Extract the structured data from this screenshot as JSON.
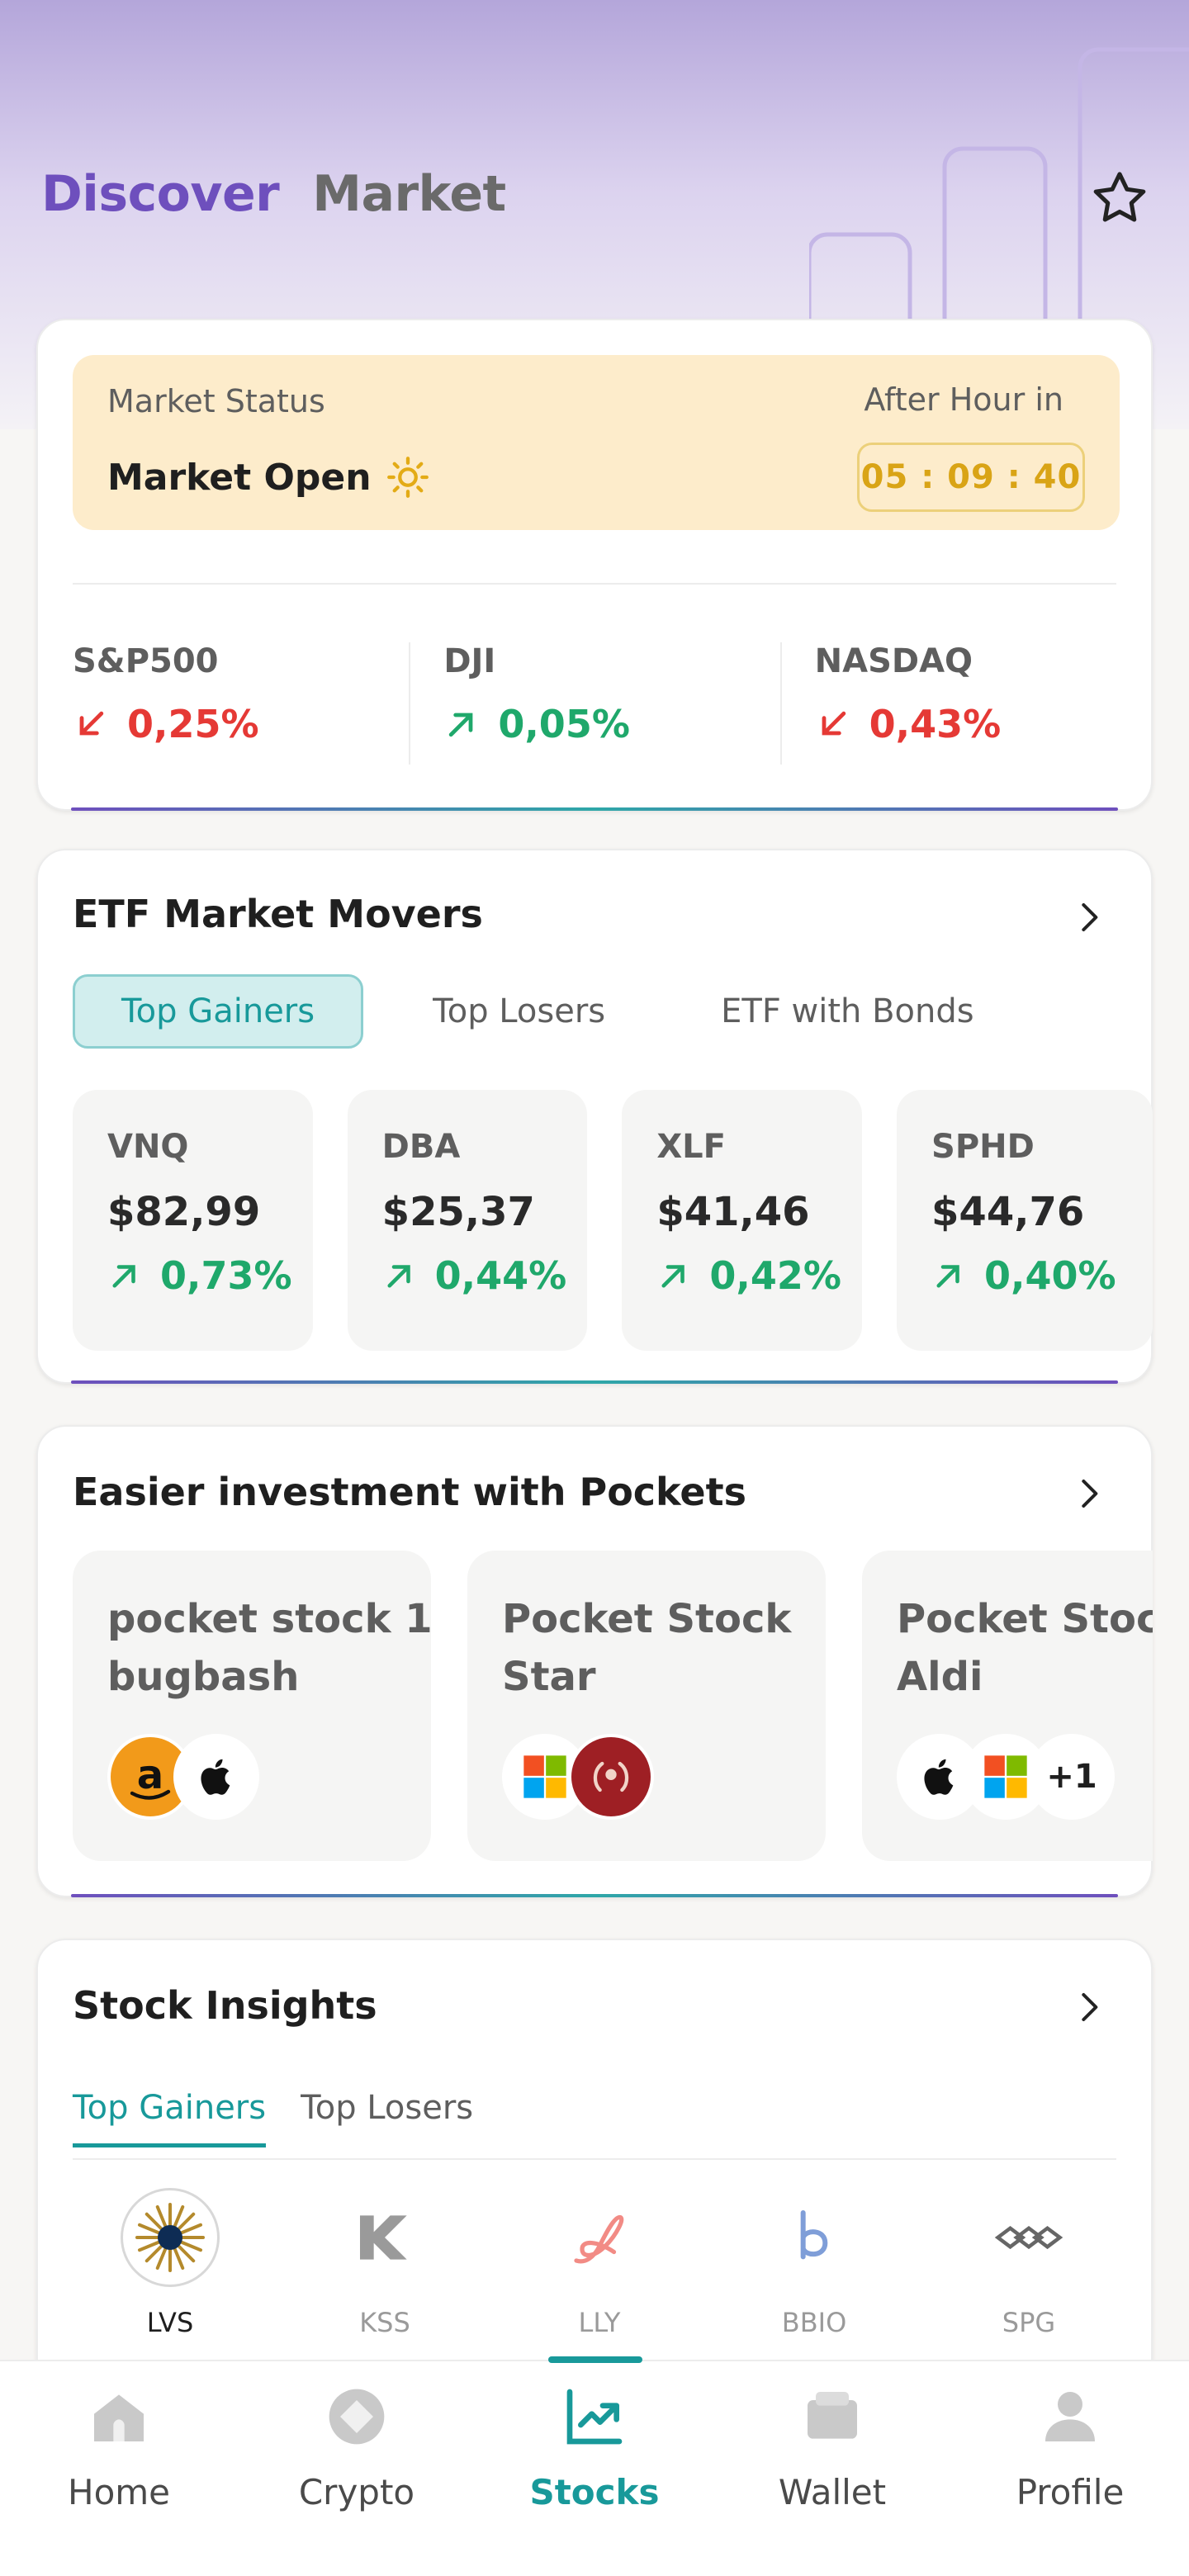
{
  "header": {
    "tabs": [
      {
        "label": "Discover",
        "active": true
      },
      {
        "label": "Market",
        "active": false
      }
    ]
  },
  "market_status": {
    "label": "Market Status",
    "status": "Market Open",
    "after_label": "After Hour in",
    "timer": "05 : 09 : 40",
    "indices": [
      {
        "name": "S&P500",
        "change": "0,25%",
        "direction": "down"
      },
      {
        "name": "DJI",
        "change": "0,05%",
        "direction": "up"
      },
      {
        "name": "NASDAQ",
        "change": "0,43%",
        "direction": "down"
      }
    ]
  },
  "etf": {
    "title": "ETF Market Movers",
    "tabs": [
      "Top Gainers",
      "Top Losers",
      "ETF with Bonds"
    ],
    "items": [
      {
        "symbol": "VNQ",
        "price": "$82,99",
        "change": "0,73%"
      },
      {
        "symbol": "DBA",
        "price": "$25,37",
        "change": "0,44%"
      },
      {
        "symbol": "XLF",
        "price": "$41,46",
        "change": "0,42%"
      },
      {
        "symbol": "SPHD",
        "price": "$44,76",
        "change": "0,40%"
      }
    ]
  },
  "pockets": {
    "title": "Easier investment with Pockets",
    "items": [
      {
        "name": "pocket stock 1 bugbash",
        "logos": [
          "amazon-logo",
          "apple-logo"
        ]
      },
      {
        "name": "Pocket Stock Star",
        "logos": [
          "microsoft-logo",
          "wreath-logo"
        ]
      },
      {
        "name": "Pocket Stock Aldi",
        "logos": [
          "apple-logo",
          "microsoft-logo"
        ],
        "extra": "+1"
      }
    ]
  },
  "insights": {
    "title": "Stock Insights",
    "tabs": [
      "Top Gainers",
      "Top Losers"
    ],
    "stocks": [
      "LVS",
      "KSS",
      "LLY",
      "BBIO",
      "SPG"
    ]
  },
  "nav": {
    "items": [
      {
        "label": "Home",
        "icon": "home-icon"
      },
      {
        "label": "Crypto",
        "icon": "crypto-icon"
      },
      {
        "label": "Stocks",
        "icon": "stocks-icon",
        "active": true
      },
      {
        "label": "Wallet",
        "icon": "wallet-icon"
      },
      {
        "label": "Profile",
        "icon": "profile-icon"
      }
    ]
  },
  "colors": {
    "accent_purple": "#6e4fbd",
    "accent_teal": "#18999a",
    "up_green": "#1fa86b",
    "down_red": "#e53935",
    "timer_gold": "#d9a416"
  }
}
